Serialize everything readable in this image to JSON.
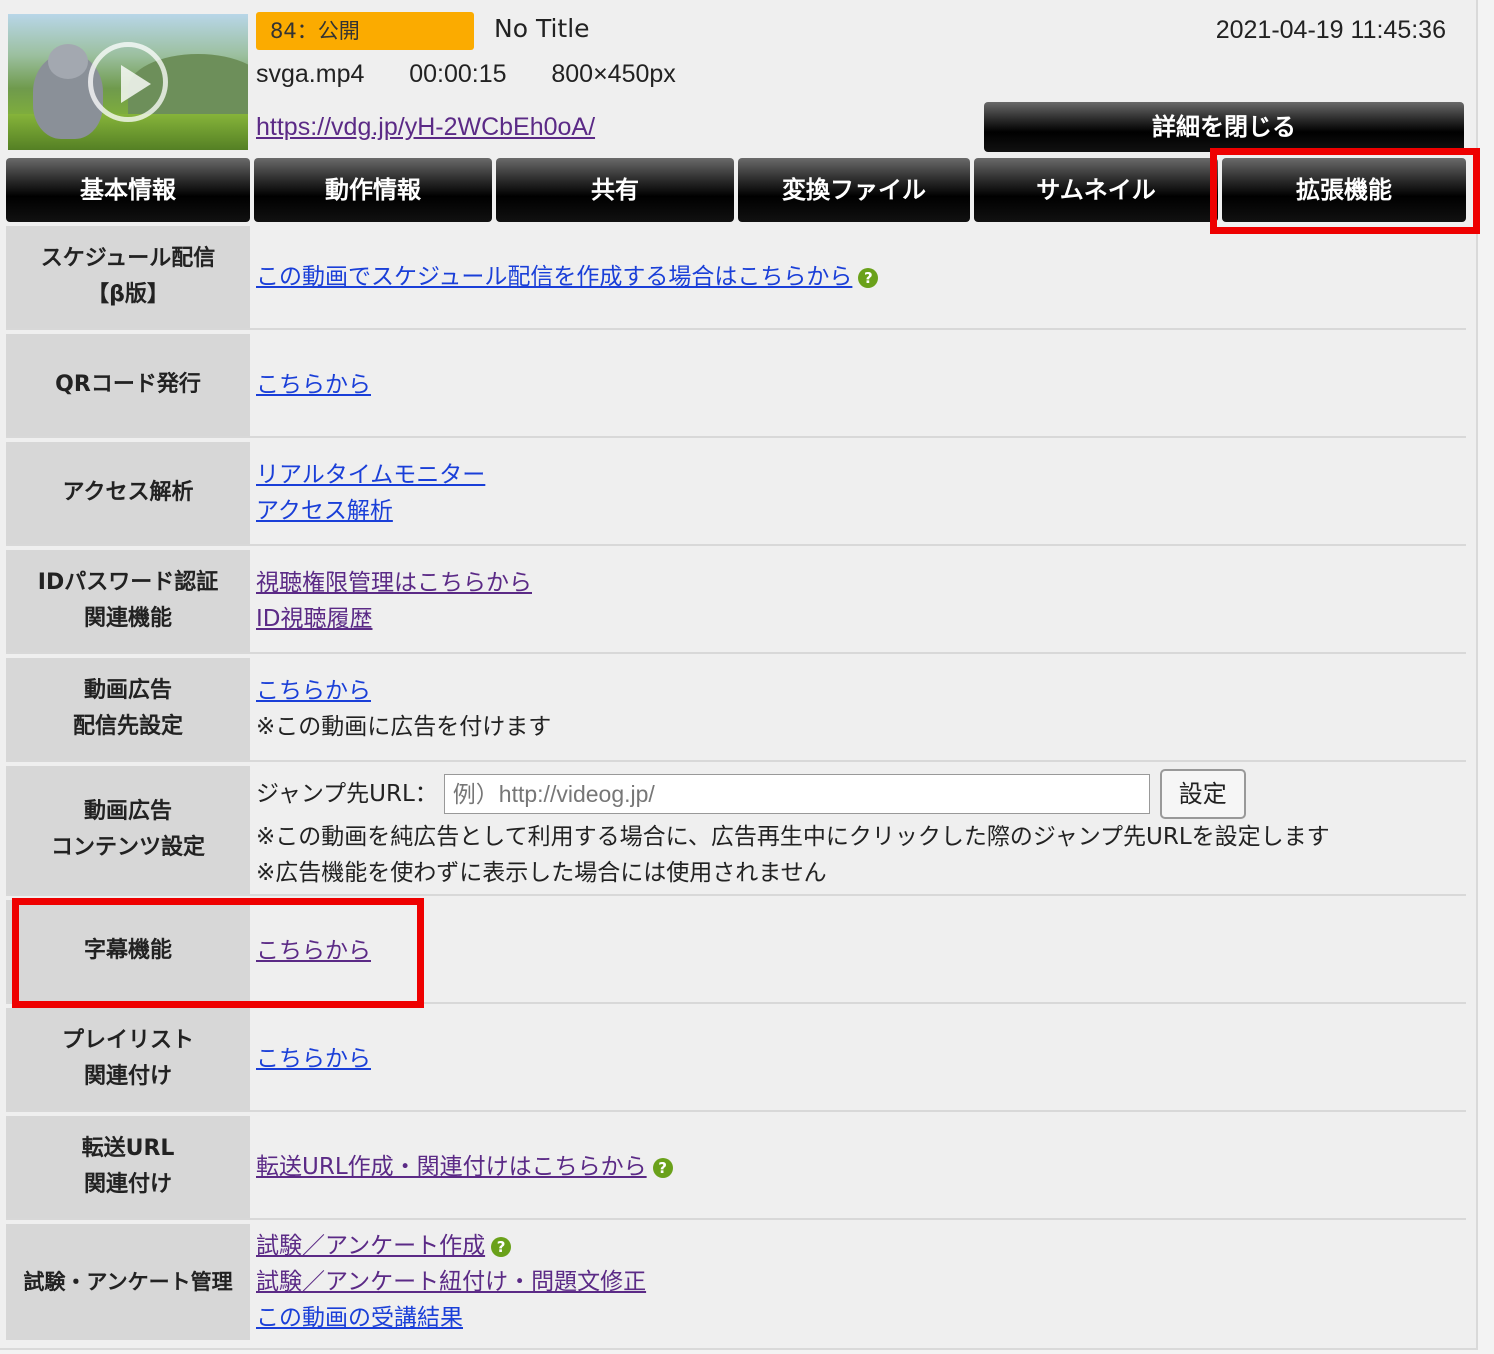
{
  "header": {
    "status_badge": "84：公開",
    "title": "No Title",
    "datetime": "2021-04-19 11:45:36",
    "file_info": "svga.mp4   00:00:15   800×450px",
    "url": "https://vdg.jp/yH-2WCbEh0oA/",
    "detail_close_label": "詳細を閉じる"
  },
  "tabs": [
    "基本情報",
    "動作情報",
    "共有",
    "変換ファイル",
    "サムネイル",
    "拡張機能"
  ],
  "rows": {
    "schedule": {
      "label": "スケジュール配信\n【β版】",
      "link": "この動画でスケジュール配信を作成する場合はこちらから"
    },
    "qr": {
      "label": "QRコード発行",
      "link": "こちらから"
    },
    "access": {
      "label": "アクセス解析",
      "link1": "リアルタイムモニター",
      "link2": "アクセス解析"
    },
    "idpass": {
      "label": "IDパスワード認証\n関連機能",
      "link1": "視聴権限管理はこちらから",
      "link2": "ID視聴履歴"
    },
    "ad_dest": {
      "label": "動画広告\n配信先設定",
      "link": "こちらから",
      "note": "※この動画に広告を付けます"
    },
    "ad_content": {
      "label": "動画広告\nコンテンツ設定",
      "jump_label": "ジャンプ先URL：",
      "input_placeholder": "例）http://videog.jp/",
      "set_button": "設定",
      "note1": "※この動画を純広告として利用する場合に、広告再生中にクリックした際のジャンプ先URLを設定します",
      "note2": "※広告機能を使わずに表示した場合には使用されません"
    },
    "subtitle": {
      "label": "字幕機能",
      "link": "こちらから"
    },
    "playlist": {
      "label": "プレイリスト\n関連付け",
      "link": "こちらから"
    },
    "forward": {
      "label": "転送URL\n関連付け",
      "link": "転送URL作成・関連付けはこちらから"
    },
    "exam": {
      "label": "試験・アンケート管理",
      "link1": "試験／アンケート作成",
      "link2": "試験／アンケート紐付け・問題文修正",
      "link3": "この動画の受講結果"
    }
  },
  "help_icon": "?",
  "colors": {
    "badge": "#fbab00",
    "highlight": "#ee0000",
    "link": "#1a3fd8",
    "visited_link": "#5b2a86",
    "help": "#6aa11a"
  }
}
